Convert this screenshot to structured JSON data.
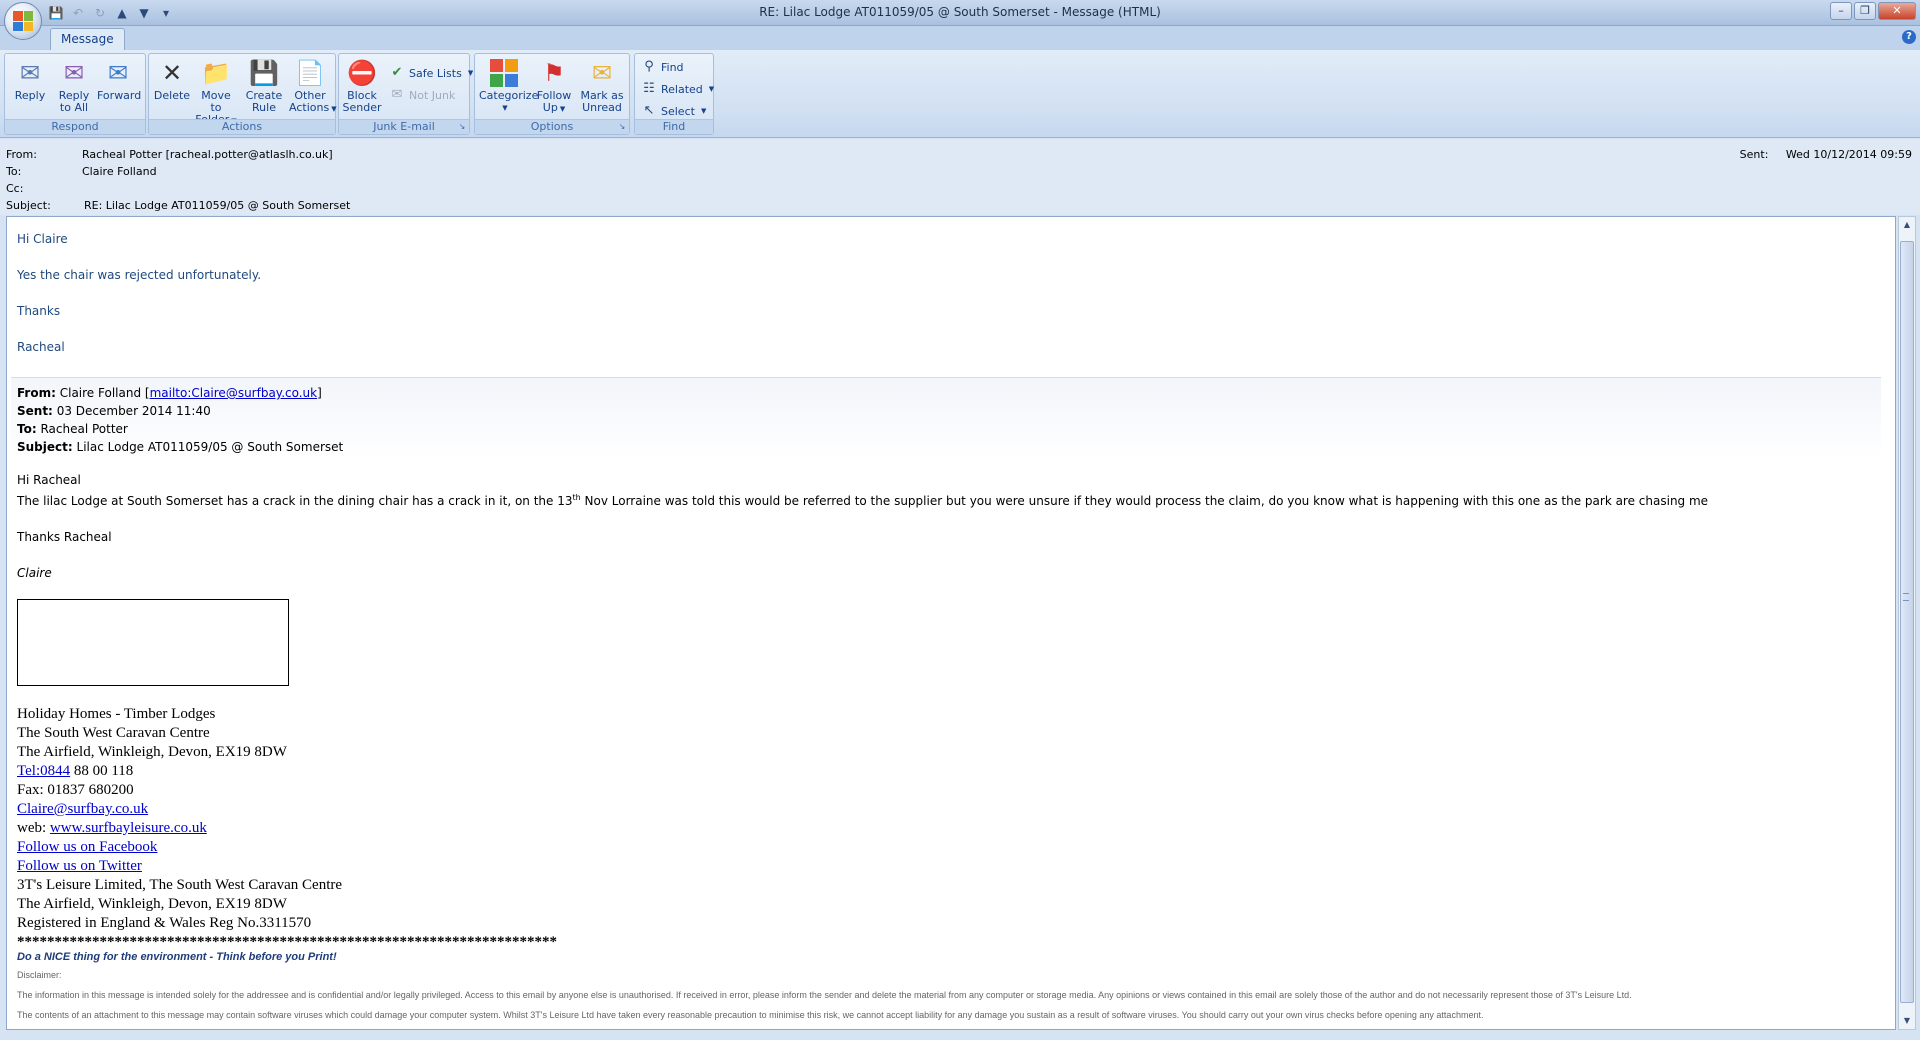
{
  "window": {
    "title": "RE: Lilac Lodge AT011059/05 @ South Somerset - Message (HTML)"
  },
  "ribbon": {
    "tab": "Message",
    "groups": {
      "respond": "Respond",
      "actions": "Actions",
      "junk": "Junk E-mail",
      "options": "Options",
      "find": "Find"
    },
    "buttons": {
      "reply": "Reply",
      "reply_all_1": "Reply",
      "reply_all_2": "to All",
      "forward": "Forward",
      "delete": "Delete",
      "move_1": "Move to",
      "move_2": "Folder",
      "create_1": "Create",
      "create_2": "Rule",
      "other_1": "Other",
      "other_2": "Actions",
      "block_1": "Block",
      "block_2": "Sender",
      "safe_lists": "Safe Lists",
      "not_junk": "Not Junk",
      "categorize": "Categorize",
      "follow_1": "Follow",
      "follow_2": "Up",
      "mark_1": "Mark as",
      "mark_2": "Unread",
      "find": "Find",
      "related": "Related",
      "select": "Select"
    }
  },
  "header": {
    "from_label": "From:",
    "from_value": "Racheal Potter [racheal.potter@atlaslh.co.uk]",
    "to_label": "To:",
    "to_value": "Claire Folland",
    "cc_label": "Cc:",
    "cc_value": "",
    "subject_label": "Subject:",
    "subject_value": "RE: Lilac Lodge AT011059/05 @ South Somerset",
    "sent_label": "Sent:",
    "sent_value": "Wed 10/12/2014 09:59"
  },
  "body": {
    "reply_lines": [
      "Hi Claire",
      "Yes the chair was rejected unfortunately.",
      "Thanks",
      "Racheal"
    ],
    "quoted": {
      "from_label": "From:",
      "from_name": "Claire Folland [",
      "from_link": "mailto:Claire@surfbay.co.uk",
      "from_end": "]",
      "sent_label": "Sent:",
      "sent_value": "03 December 2014 11:40",
      "to_label": "To:",
      "to_value": "Racheal Potter",
      "subject_label": "Subject:",
      "subject_value": "Lilac Lodge AT011059/05 @ South Somerset"
    },
    "greeting": "Hi Racheal",
    "para_start": "The lilac Lodge at South Somerset has a crack in the dining chair has a crack in it, on the 13",
    "para_sup": "th",
    "para_end": " Nov Lorraine was told this would be referred to the supplier but you were unsure if they would process the claim, do you know what is happening with this one as the park are chasing me",
    "thanks": "Thanks Racheal",
    "signature": "Claire",
    "address": {
      "line1": "Holiday Homes - Timber Lodges",
      "line2": "The South West Caravan Centre",
      "line3": "The Airfield, Winkleigh, Devon, EX19 8DW",
      "tel_link": "Tel:0844",
      "tel_rest": " 88 00 118",
      "fax": "Fax: 01837 680200",
      "email": "Claire@surfbay.co.uk",
      "web_label": "web: ",
      "web_link": "www.surfbayleisure.co.uk",
      "facebook": "Follow us on Facebook",
      "twitter": "Follow us on Twitter",
      "company1": "3T's Leisure Limited, The South West Caravan Centre",
      "company2": "The Airfield, Winkleigh, Devon, EX19 8DW",
      "company3": "Registered in England & Wales Reg No.3311570",
      "stars": "************************************************************************"
    },
    "footer": {
      "nice": "Do a NICE thing for the environment - Think before you Print!",
      "disclaimer_label": "Disclaimer:",
      "disclaimer_text": "The information in this message is intended solely for the addressee and is confidential and/or legally privileged. Access to this email by anyone else is unauthorised. If received in error, please inform the sender and delete the material from any computer or storage media. Any opinions or views contained in this email are solely those of the author and do not necessarily represent those of  3T's Leisure Ltd.",
      "virus_text": "The contents of an attachment to this message may contain software viruses which could damage your computer system.  Whilst 3T's Leisure Ltd have taken every reasonable precaution to minimise this risk, we cannot accept liability for any damage you sustain as a result of software viruses.  You should carry out your own virus checks before opening any attachment."
    }
  }
}
